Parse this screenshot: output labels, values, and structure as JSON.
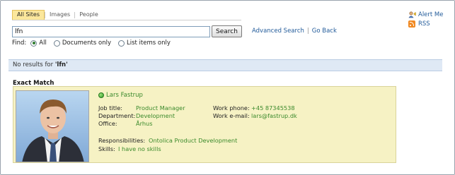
{
  "tabs": [
    {
      "label": "All Sites",
      "active": true
    },
    {
      "label": "Images",
      "active": false
    },
    {
      "label": "People",
      "active": false
    }
  ],
  "search": {
    "value": "lfn",
    "button_label": "Search"
  },
  "links": {
    "advanced_search": "Advanced Search",
    "separator": "|",
    "go_back": "Go Back"
  },
  "find": {
    "label": "Find:",
    "options": [
      {
        "label": "All",
        "selected": true
      },
      {
        "label": "Documents only",
        "selected": false
      },
      {
        "label": "List items only",
        "selected": false
      }
    ]
  },
  "right_links": {
    "alert_me": "Alert Me",
    "rss": "RSS"
  },
  "status": {
    "prefix": "No results for ",
    "query_quoted": "'lfn'"
  },
  "exact_match": {
    "title": "Exact Match",
    "name": "Lars Fastrup",
    "job_title_label": "Job title:",
    "job_title": "Product Manager",
    "department_label": "Department:",
    "department": "Development",
    "office_label": "Office:",
    "office": "Århus",
    "work_phone_label": "Work phone:",
    "work_phone": "+45 87345538",
    "work_email_label": "Work e-mail:",
    "work_email": "lars@fastrup.dk",
    "responsibilities_label": "Responsibilities:",
    "responsibilities": "Ontolica Product Development",
    "skills_label": "Skills:",
    "skills": "I have no skills"
  },
  "colors": {
    "link": "#225b9a",
    "green_value": "#3b8a2c",
    "card_bg": "#f6f2c4",
    "status_bg": "#dfe9f5",
    "active_tab": "#fbe79c"
  },
  "icons": {
    "alert": "alert-me-icon",
    "rss": "rss-icon",
    "presence": "presence-online-icon"
  }
}
